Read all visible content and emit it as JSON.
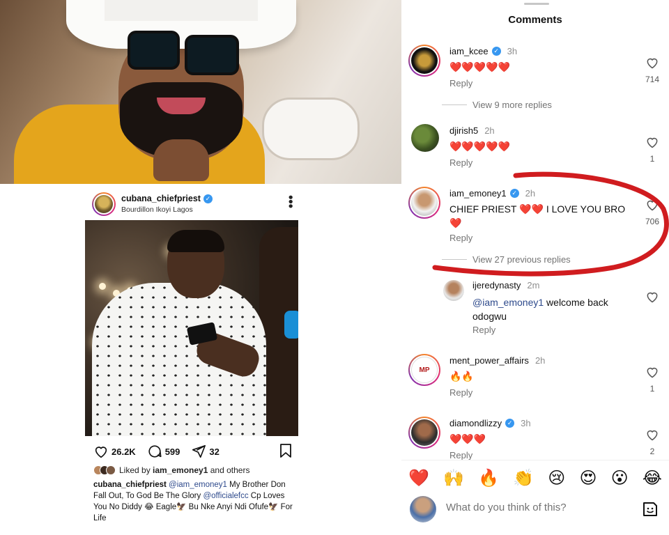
{
  "post": {
    "username": "cubana_chiefpriest",
    "location": "Bourdillon Ikoyi Lagos",
    "likes": "26.2K",
    "comments": "599",
    "shares": "32",
    "liked_by_prefix": "Liked by ",
    "liked_by_user": "iam_emoney1",
    "liked_by_suffix": " and others",
    "caption_user": "cubana_chiefpriest",
    "caption_mention1": "@iam_emoney1",
    "caption_part1": " My Brother Don Fall Out, To God Be The Glory ",
    "caption_mention2": "@officialefcc",
    "caption_part2": " Cp Loves You No Diddy 😂 Eagle🦅 Bu Nke Anyi Ndi Ofufe🦅 For Life"
  },
  "comments_panel": {
    "title": "Comments",
    "items": [
      {
        "user": "iam_kcee",
        "verified": true,
        "time": "3h",
        "text": "❤️❤️❤️❤️❤️",
        "reply": "Reply",
        "likes": "714"
      },
      {
        "user": "djirish5",
        "verified": false,
        "time": "2h",
        "text": "❤️❤️❤️❤️❤️",
        "reply": "Reply",
        "likes": "1"
      },
      {
        "user": "iam_emoney1",
        "verified": true,
        "time": "2h",
        "text": "CHIEF PRIEST ❤️❤️ I LOVE YOU BRO ❤️",
        "reply": "Reply",
        "likes": "706"
      },
      {
        "user": "ijeredynasty",
        "verified": false,
        "time": "2m",
        "mention": "@iam_emoney1",
        "text": " welcome back odogwu",
        "reply": "Reply",
        "likes": ""
      },
      {
        "user": "ment_power_affairs",
        "verified": false,
        "time": "2h",
        "text": "🔥🔥",
        "reply": "Reply",
        "likes": "1"
      },
      {
        "user": "diamondlizzy",
        "verified": true,
        "time": "3h",
        "text": "❤️❤️❤️",
        "reply": "Reply",
        "likes": "2"
      }
    ],
    "view_more_1": "View 9 more replies",
    "view_more_2": "View 27 previous replies",
    "emojis": [
      "❤️",
      "🙌",
      "🔥",
      "👏",
      "😢",
      "😍",
      "😮",
      "😂"
    ],
    "input_placeholder": "What do you think of this?"
  },
  "colors": {
    "accent_blue": "#3797f0",
    "mention": "#2e4a8c",
    "highlight_red": "#d01c1f"
  }
}
